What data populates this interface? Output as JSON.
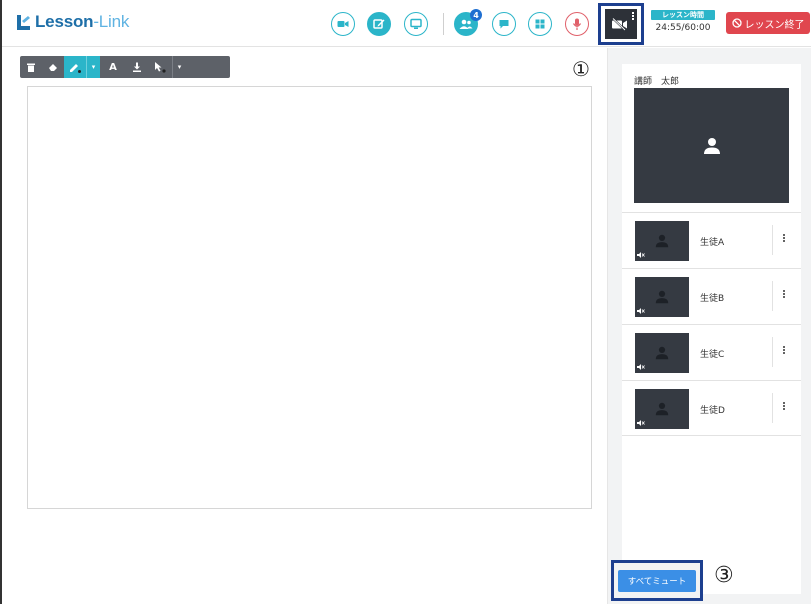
{
  "app": {
    "logo_main": "Lesson",
    "logo_dash": "-",
    "logo_sub": "Link"
  },
  "header": {
    "participants_count": "4",
    "lesson_time_label": "レッスン時間",
    "lesson_time_value": "24:55/60:00",
    "end_button_label": "レッスン終了"
  },
  "annotations": {
    "marker_1": "①",
    "marker_3": "③"
  },
  "teacher": {
    "name": "講師　太郎"
  },
  "students": [
    {
      "name": "生徒A"
    },
    {
      "name": "生徒B"
    },
    {
      "name": "生徒C"
    },
    {
      "name": "生徒D"
    }
  ],
  "mute_all": {
    "label": "すべてミュート"
  },
  "colors": {
    "accent": "#2bb5c9",
    "brand": "#1e6fa8",
    "danger": "#e0464e",
    "video_bg": "#353a42",
    "highlight_box": "#1d3f8f"
  }
}
